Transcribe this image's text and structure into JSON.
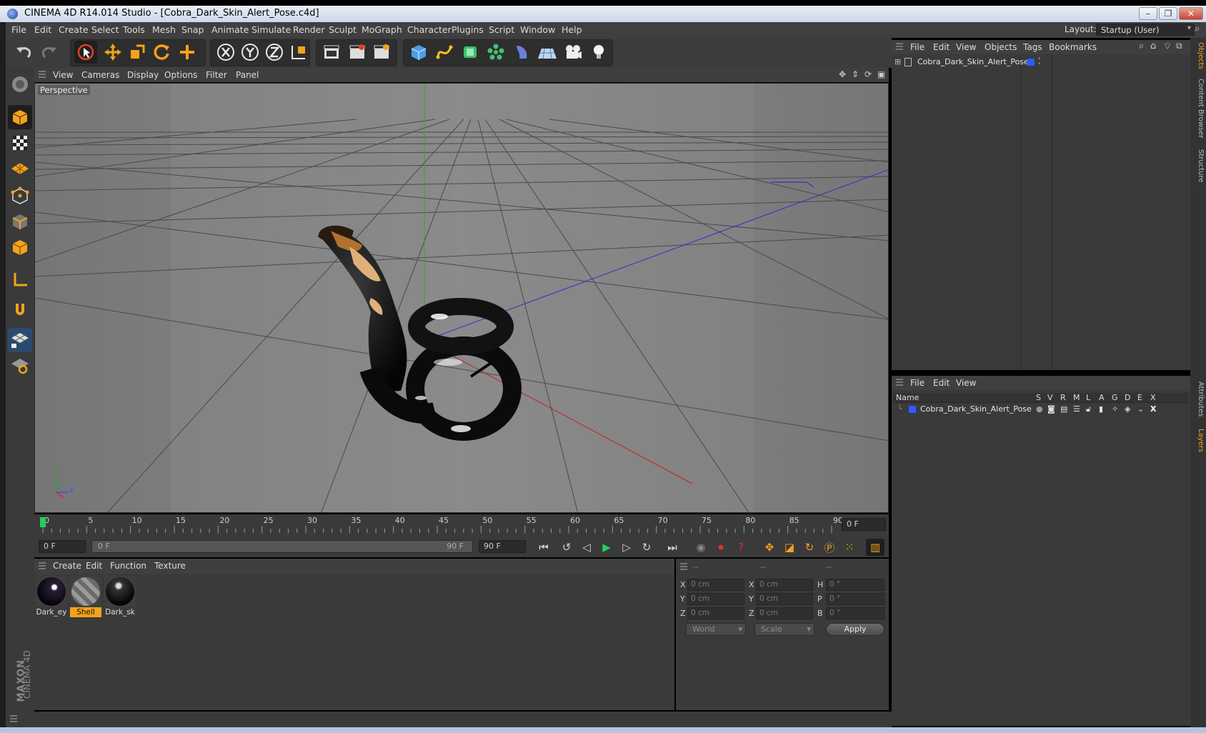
{
  "window": {
    "title": "CINEMA 4D R14.014 Studio - [Cobra_Dark_Skin_Alert_Pose.c4d]",
    "controls": {
      "minimize": "–",
      "maximize": "❐",
      "close": "✕"
    }
  },
  "menu": {
    "items": [
      "File",
      "Edit",
      "Create",
      "Select",
      "Tools",
      "Mesh",
      "Snap",
      "Animate",
      "Simulate",
      "Render",
      "Sculpt",
      "MoGraph",
      "Character",
      "Plugins",
      "Script",
      "Window",
      "Help"
    ],
    "layout_label": "Layout:",
    "layout_value": "Startup (User)"
  },
  "toolbar": {
    "icons": [
      "undo-icon",
      "redo-icon",
      "live-select-icon",
      "move-icon",
      "scale-icon",
      "rotate-icon",
      "add-icon",
      "x-axis-icon",
      "y-axis-icon",
      "z-axis-icon",
      "coordinate-system-icon",
      "render-view-icon",
      "render-picture-viewer-icon",
      "edit-render-settings-icon",
      "cube-icon",
      "spline-icon",
      "nurbs-icon",
      "array-icon",
      "deformer-icon",
      "scene-floor-icon",
      "camera-icon",
      "light-icon"
    ]
  },
  "viewport": {
    "menu": [
      "View",
      "Cameras",
      "Display",
      "Options",
      "Filter",
      "Panel"
    ],
    "label": "Perspective",
    "axis_labels": {
      "y": "Y",
      "z": "Z"
    }
  },
  "timeline": {
    "ticks": [
      "0",
      "5",
      "10",
      "15",
      "20",
      "25",
      "30",
      "35",
      "40",
      "45",
      "50",
      "55",
      "60",
      "65",
      "70",
      "75",
      "80",
      "85",
      "90"
    ],
    "current_frame": "0 F",
    "start_frame": "0 F",
    "range_start": "0 F",
    "range_end": "90 F",
    "end_frame": "90 F"
  },
  "materials": {
    "menu": [
      "Create",
      "Edit",
      "Function",
      "Texture"
    ],
    "items": [
      {
        "label": "Dark_ey",
        "selected": false
      },
      {
        "label": "Shell",
        "selected": true
      },
      {
        "label": "Dark_sk",
        "selected": false
      }
    ]
  },
  "coords": {
    "headers": [
      "--",
      "--",
      "--"
    ],
    "rows": [
      {
        "label_a": "X",
        "value_a": "0 cm",
        "label_b": "X",
        "value_b": "0 cm",
        "label_c": "H",
        "value_c": "0 °"
      },
      {
        "label_a": "Y",
        "value_a": "0 cm",
        "label_b": "Y",
        "value_b": "0 cm",
        "label_c": "P",
        "value_c": "0 °"
      },
      {
        "label_a": "Z",
        "value_a": "0 cm",
        "label_b": "Z",
        "value_b": "0 cm",
        "label_c": "B",
        "value_c": "0 °"
      }
    ],
    "mode1": "World",
    "mode2": "Scale",
    "apply": "Apply"
  },
  "objects": {
    "menu": [
      "File",
      "Edit",
      "View",
      "Objects",
      "Tags",
      "Bookmarks"
    ],
    "item": "Cobra_Dark_Skin_Alert_Pose"
  },
  "layers": {
    "menu": [
      "File",
      "Edit",
      "View"
    ],
    "name_header": "Name",
    "columns": [
      "S",
      "V",
      "R",
      "M",
      "L",
      "A",
      "G",
      "D",
      "E",
      "X"
    ],
    "item": "Cobra_Dark_Skin_Alert_Pose"
  },
  "side_tabs": [
    "Objects",
    "Content Browser",
    "Structure",
    "Attributes",
    "Layers"
  ],
  "branding": {
    "maxon": "MAXON",
    "product": "CINEMA 4D"
  },
  "colors": {
    "accent": "#f5a21a",
    "layer_blue": "#2f5bff",
    "panel": "#3a3a3a"
  }
}
